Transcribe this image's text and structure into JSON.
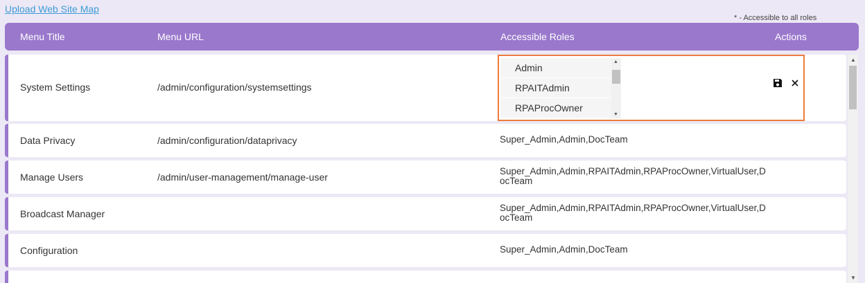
{
  "upload_link": "Upload Web Site Map",
  "note": "* - Accessible to all roles",
  "header": {
    "title": "Menu Title",
    "url": "Menu URL",
    "roles": "Accessible Roles",
    "actions": "Actions"
  },
  "editing_row": {
    "title": "System Settings",
    "url": "/admin/configuration/systemsettings",
    "role_options": [
      "Admin",
      "RPAITAdmin",
      "RPAProcOwner"
    ]
  },
  "rows": [
    {
      "title": "Data Privacy",
      "url": "/admin/configuration/dataprivacy",
      "roles": "Super_Admin,Admin,DocTeam"
    },
    {
      "title": "Manage Users",
      "url": "/admin/user-management/manage-user",
      "roles": "Super_Admin,Admin,RPAITAdmin,RPAProcOwner,VirtualUser,DocTeam"
    },
    {
      "title": "Broadcast Manager",
      "url": "",
      "roles": "Super_Admin,Admin,RPAITAdmin,RPAProcOwner,VirtualUser,DocTeam"
    },
    {
      "title": "Configuration",
      "url": "",
      "roles": "Super_Admin,Admin,DocTeam"
    }
  ],
  "icons": {
    "save": "save-icon",
    "close": "close-icon"
  },
  "colors": {
    "header": "#9a78cc",
    "highlight": "#ee7b3c",
    "link": "#3d9bd6"
  }
}
